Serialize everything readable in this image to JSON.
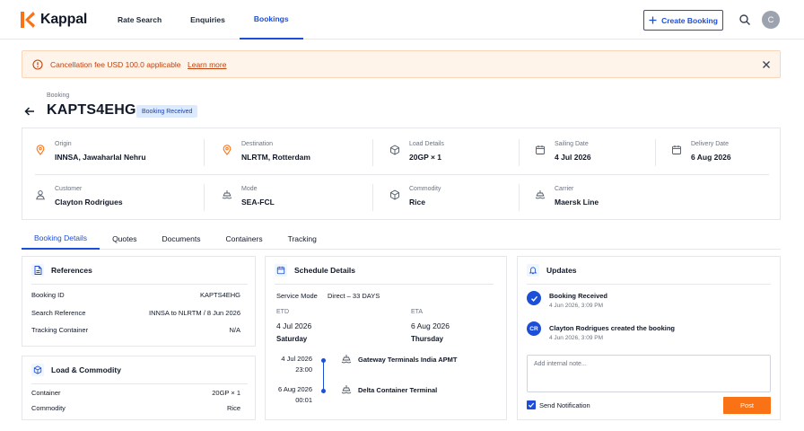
{
  "app": {
    "name": "Kappal"
  },
  "nav": {
    "items": [
      {
        "label": "Rate Search"
      },
      {
        "label": "Enquiries"
      },
      {
        "label": "Bookings",
        "active": true
      }
    ]
  },
  "header_actions": {
    "create_label": "Create Booking",
    "avatar_initial": "C"
  },
  "banner": {
    "message": "Cancellation fee USD 100.0 applicable",
    "link": "Learn more"
  },
  "booking": {
    "breadcrumb": "Booking",
    "id": "KAPTS4EHG",
    "status": "Booking Received"
  },
  "summary": {
    "origin": {
      "label": "Origin",
      "value": "INNSA, Jawaharlal Nehru"
    },
    "destination": {
      "label": "Destination",
      "value": "NLRTM, Rotterdam"
    },
    "load": {
      "label": "Load Details",
      "value": "20GP × 1"
    },
    "sailing": {
      "label": "Sailing Date",
      "value": "4 Jul 2026"
    },
    "delivery": {
      "label": "Delivery Date",
      "value": "6 Aug 2026"
    },
    "customer": {
      "label": "Customer",
      "value": "Clayton Rodrigues"
    },
    "mode": {
      "label": "Mode",
      "value": "SEA-FCL"
    },
    "commodity": {
      "label": "Commodity",
      "value": "Rice"
    },
    "carrier": {
      "label": "Carrier",
      "value": "Maersk Line"
    }
  },
  "tabs": [
    {
      "label": "Booking Details",
      "active": true
    },
    {
      "label": "Quotes"
    },
    {
      "label": "Documents"
    },
    {
      "label": "Containers"
    },
    {
      "label": "Tracking"
    }
  ],
  "references": {
    "title": "References",
    "rows": [
      {
        "label": "Booking ID",
        "value": "KAPTS4EHG"
      },
      {
        "label": "Search Reference",
        "value": "INNSA to NLRTM / 8 Jun 2026"
      },
      {
        "label": "Tracking Container",
        "value": "N/A"
      }
    ]
  },
  "load_commodity": {
    "title": "Load & Commodity",
    "rows": [
      {
        "label": "Container",
        "value": "20GP × 1"
      },
      {
        "label": "Commodity",
        "value": "Rice"
      }
    ]
  },
  "schedule": {
    "title": "Schedule Details",
    "service_mode_label": "Service Mode",
    "service_mode_value": "Direct – 33 DAYS",
    "etd_label": "ETD",
    "etd_date": "4 Jul 2026",
    "etd_day": "Saturday",
    "eta_label": "ETA",
    "eta_date": "6 Aug 2026",
    "eta_day": "Thursday",
    "timeline": [
      {
        "date": "4 Jul 2026",
        "time": "23:00",
        "place": "Gateway Terminals India APMT"
      },
      {
        "date": "6 Aug 2026",
        "time": "00:01",
        "place": "Delta Container Terminal"
      }
    ]
  },
  "updates": {
    "title": "Updates",
    "items": [
      {
        "title": "Booking Received",
        "time": "4 Jun 2026, 3:09 PM",
        "icon": "check-icon"
      },
      {
        "title": "Clayton Rodrigues created the booking",
        "time": "4 Jun 2026, 3:09 PM",
        "initials": "CR"
      }
    ],
    "note_placeholder": "Add internal note...",
    "notify_label": "Send Notification",
    "post_label": "Post"
  },
  "colors": {
    "accent": "#1d4ed8",
    "warning": "#c2410c",
    "post": "#f97316",
    "brand": "#f97316"
  }
}
